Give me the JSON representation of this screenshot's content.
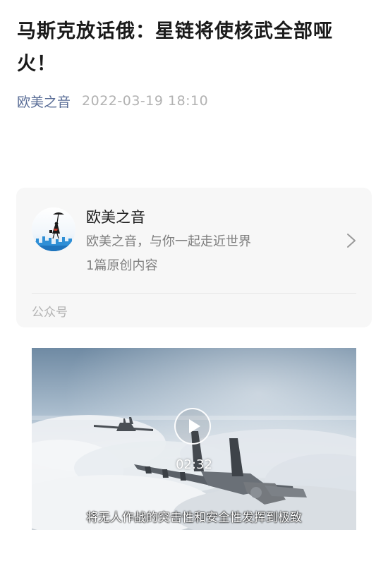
{
  "article": {
    "title": "马斯克放话俄：星链将使核武全部哑火！",
    "author": "欧美之音",
    "publish_time": "2022-03-19 18:10"
  },
  "account_card": {
    "name": "欧美之音",
    "description": "欧美之音，与你一起走近世界",
    "original_count": "1篇原创内容",
    "footer_label": "公众号",
    "avatar_icon": "umbrella-lady-avatar-icon"
  },
  "video": {
    "duration": "02:32",
    "subtitle": "将无人作战的突击性和安全性发挥到极致",
    "play_icon": "play-icon"
  },
  "colors": {
    "author_link": "#576b95",
    "timestamp": "#b2b2b2",
    "card_background": "#f7f7f7"
  }
}
